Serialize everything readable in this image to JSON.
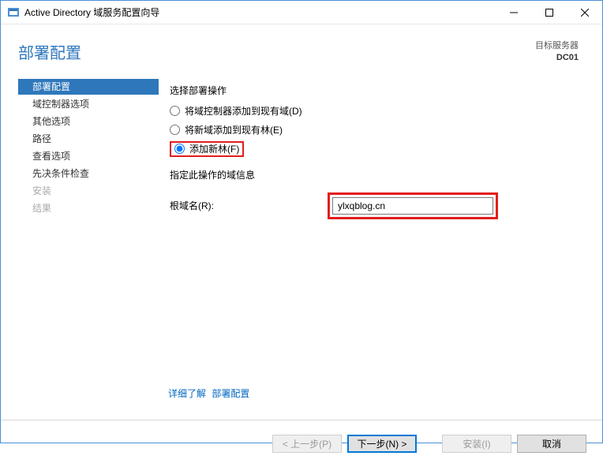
{
  "window": {
    "title": "Active Directory 域服务配置向导"
  },
  "header": {
    "page_title": "部署配置",
    "target_server_label": "目标服务器",
    "target_server_name": "DC01"
  },
  "sidebar": {
    "items": [
      {
        "label": "部署配置",
        "state": "selected"
      },
      {
        "label": "域控制器选项",
        "state": "normal"
      },
      {
        "label": "其他选项",
        "state": "normal"
      },
      {
        "label": "路径",
        "state": "normal"
      },
      {
        "label": "查看选项",
        "state": "normal"
      },
      {
        "label": "先决条件检查",
        "state": "normal"
      },
      {
        "label": "安装",
        "state": "disabled"
      },
      {
        "label": "结果",
        "state": "disabled"
      }
    ]
  },
  "content": {
    "select_op_label": "选择部署操作",
    "radios": [
      {
        "label": "将域控制器添加到现有域(D)",
        "checked": false
      },
      {
        "label": "将新域添加到现有林(E)",
        "checked": false
      },
      {
        "label": "添加新林(F)",
        "checked": true
      }
    ],
    "domain_info_label": "指定此操作的域信息",
    "root_domain_label": "根域名(R):",
    "root_domain_value": "ylxqblog.cn"
  },
  "links": {
    "more_label": "详细了解",
    "topic_label": "部署配置"
  },
  "footer": {
    "prev": "< 上一步(P)",
    "next": "下一步(N) >",
    "install": "安装(I)",
    "cancel": "取消"
  }
}
